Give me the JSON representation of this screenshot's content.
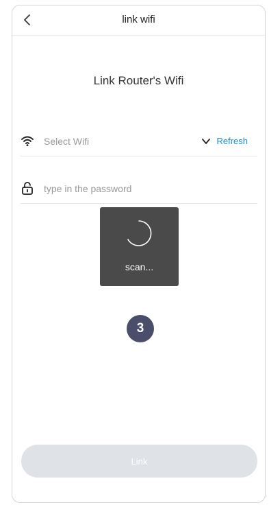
{
  "header": {
    "title": "link wifi",
    "back_icon": "chevron-left-icon"
  },
  "main": {
    "title": "Link Router's Wifi",
    "wifi_field": {
      "icon": "wifi-icon",
      "placeholder": "Select Wifi",
      "dropdown_icon": "chevron-down-icon",
      "refresh_label": "Refresh"
    },
    "password_field": {
      "icon": "unlock-icon",
      "placeholder": "type in the password"
    }
  },
  "toast": {
    "label": "scan...",
    "icon": "spinner-icon"
  },
  "step_badge": {
    "label": "3"
  },
  "footer": {
    "link_label": "Link"
  },
  "colors": {
    "accent": "#1a8fd6",
    "toast_bg": "#4a4a4a",
    "badge_bg": "#4a4e6b",
    "button_disabled_bg": "#dfe2e6"
  }
}
